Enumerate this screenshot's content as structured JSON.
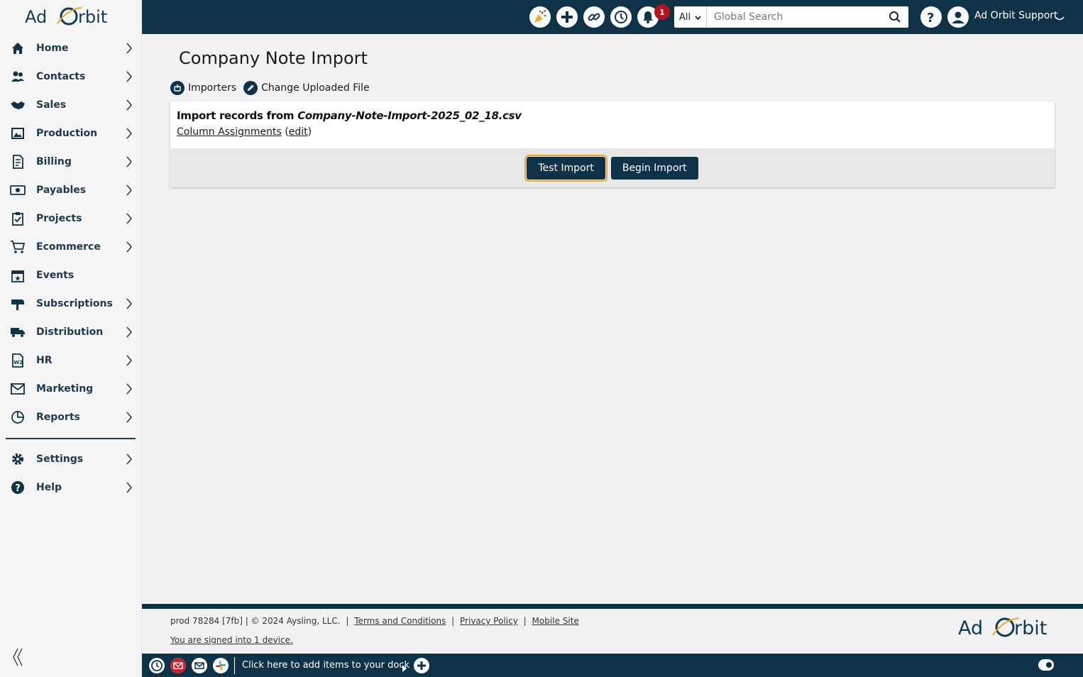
{
  "brand": {
    "logo_text": "Ad Orbit",
    "primary_color": "#0e3349",
    "focus_color": "#f0a82a",
    "badge_color": "#b3141c"
  },
  "sidebar": {
    "items": [
      {
        "label": "Home",
        "icon": "home-icon",
        "has_submenu": true
      },
      {
        "label": "Contacts",
        "icon": "people-icon",
        "has_submenu": true
      },
      {
        "label": "Sales",
        "icon": "handshake-icon",
        "has_submenu": true
      },
      {
        "label": "Production",
        "icon": "image-icon",
        "has_submenu": true
      },
      {
        "label": "Billing",
        "icon": "invoice-icon",
        "has_submenu": true
      },
      {
        "label": "Payables",
        "icon": "money-icon",
        "has_submenu": true
      },
      {
        "label": "Projects",
        "icon": "clipboard-icon",
        "has_submenu": true
      },
      {
        "label": "Ecommerce",
        "icon": "cart-icon",
        "has_submenu": true
      },
      {
        "label": "Events",
        "icon": "calendar-icon",
        "has_submenu": false
      },
      {
        "label": "Subscriptions",
        "icon": "mailbox-icon",
        "has_submenu": true
      },
      {
        "label": "Distribution",
        "icon": "truck-icon",
        "has_submenu": true
      },
      {
        "label": "HR",
        "icon": "w2-form-icon",
        "has_submenu": true
      },
      {
        "label": "Marketing",
        "icon": "envelope-icon",
        "has_submenu": true
      },
      {
        "label": "Reports",
        "icon": "chart-icon",
        "has_submenu": true
      }
    ],
    "bottom_items": [
      {
        "label": "Settings",
        "icon": "gear-icon",
        "has_submenu": true
      },
      {
        "label": "Help",
        "icon": "help-icon",
        "has_submenu": true
      }
    ]
  },
  "topbar": {
    "notification_count": "1",
    "search": {
      "scope": "All",
      "placeholder": "Global Search"
    },
    "user_name": "Ad Orbit Support"
  },
  "page": {
    "title": "Company Note Import",
    "actions": {
      "importers": "Importers",
      "change_file": "Change Uploaded File"
    },
    "import_prefix": "Import records from ",
    "import_file": "Company-Note-Import-2025_02_18.csv",
    "column_assignments": "Column Assignments",
    "edit_open": "(",
    "edit_label": "edit",
    "edit_close": ")",
    "buttons": {
      "test": "Test Import",
      "begin": "Begin Import"
    }
  },
  "footer": {
    "build": "prod 78284 [7fb] | © 2024 Aysling, LLC.",
    "terms": "Terms and Conditions",
    "privacy": "Privacy Policy",
    "mobile": "Mobile Site",
    "separator": "|",
    "signed_in": "You are signed into 1 device."
  },
  "dock": {
    "prompt": "Click here to add items to your dock"
  }
}
